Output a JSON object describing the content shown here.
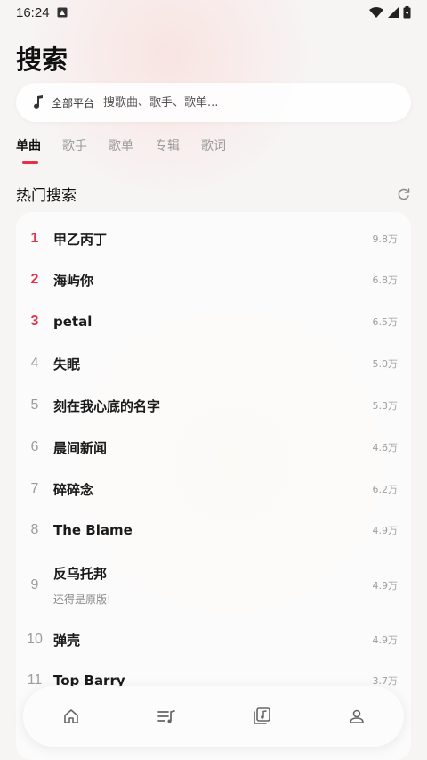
{
  "status_bar": {
    "time": "16:24"
  },
  "page_title": "搜索",
  "search": {
    "platform_label": "全部平台",
    "placeholder": "搜歌曲、歌手、歌单..."
  },
  "tabs": [
    {
      "label": "单曲",
      "active": true
    },
    {
      "label": "歌手",
      "active": false
    },
    {
      "label": "歌单",
      "active": false
    },
    {
      "label": "专辑",
      "active": false
    },
    {
      "label": "歌词",
      "active": false
    }
  ],
  "hot_search": {
    "title": "热门搜索",
    "items": [
      {
        "rank": "1",
        "title": "甲乙丙丁",
        "count": "9.8万"
      },
      {
        "rank": "2",
        "title": "海屿你",
        "count": "6.8万"
      },
      {
        "rank": "3",
        "title": "petal",
        "count": "6.5万"
      },
      {
        "rank": "4",
        "title": "失眠",
        "count": "5.0万"
      },
      {
        "rank": "5",
        "title": "刻在我心底的名字",
        "count": "5.3万"
      },
      {
        "rank": "6",
        "title": "晨间新闻",
        "count": "4.6万"
      },
      {
        "rank": "7",
        "title": "碎碎念",
        "count": "6.2万"
      },
      {
        "rank": "8",
        "title": "The Blame",
        "count": "4.9万"
      },
      {
        "rank": "9",
        "title": "反乌托邦",
        "subtitle": "还得是原版!",
        "count": "4.9万"
      },
      {
        "rank": "10",
        "title": "弹壳",
        "count": "4.9万"
      },
      {
        "rank": "11",
        "title": "Top Barry",
        "count": "3.7万"
      }
    ]
  },
  "bottom_nav": {
    "items": [
      {
        "icon": "home-icon"
      },
      {
        "icon": "playlist-icon"
      },
      {
        "icon": "music-library-icon"
      },
      {
        "icon": "profile-icon"
      }
    ]
  },
  "colors": {
    "accent": "#e5304a",
    "background": "#f7f4f4"
  }
}
